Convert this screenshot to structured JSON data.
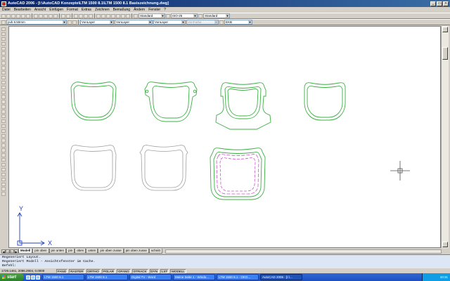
{
  "window": {
    "title": "AutoCAD 2006 - [I:\\AutoCAD Konzepte\\LTM 1500 8.1\\LTM 1500 8.1 Basiszeichnung.dwg]",
    "minimize_label": "_",
    "maximize_label": "□",
    "close_label": "×"
  },
  "menu": {
    "items": [
      {
        "label": "Datei"
      },
      {
        "label": "Bearbeiten"
      },
      {
        "label": "Ansicht"
      },
      {
        "label": "Einfügen"
      },
      {
        "label": "Format"
      },
      {
        "label": "Extras"
      },
      {
        "label": "Zeichnen"
      },
      {
        "label": "Bemaßung"
      },
      {
        "label": "Ändern"
      },
      {
        "label": "Fenster"
      },
      {
        "label": "?"
      }
    ]
  },
  "toolbar": {
    "textstyle": "Standard",
    "dimstyle": "ISO-25",
    "tablestyle": "Standard",
    "layer": "pvb 8.50mm",
    "color": "VonLayer",
    "linetype": "VonLayer",
    "lineweight": "VonLayer",
    "plotstyle": "VonFarbe",
    "extra": "EKB"
  },
  "drawing": {
    "ucs_y": "Y",
    "ucs_x": "X"
  },
  "tabs": {
    "items": [
      {
        "label": "Modell"
      },
      {
        "label": "pin oben"
      },
      {
        "label": "pin unten"
      },
      {
        "label": "pin"
      },
      {
        "label": "oben"
      },
      {
        "label": "unten"
      },
      {
        "label": "pin oben zusse"
      },
      {
        "label": "pin oben zusse"
      },
      {
        "label": "schnitt"
      }
    ]
  },
  "command": {
    "lines": [
      "Regeneriert Layout.",
      "Regeneriert Modell - Ansichtsfenster im Cache."
    ],
    "prompt": "Befehl:"
  },
  "status": {
    "coords": "1729.1461, 2096.2904, 0.0000",
    "buttons": [
      "FANG",
      "RASTER",
      "ORTHO",
      "POLAR",
      "OFANG",
      "OTRACK",
      "DYN",
      "LST",
      "MODELL"
    ]
  },
  "taskbar": {
    "start_label": "start",
    "tasks": [
      {
        "label": "LTM 1500 8.1"
      },
      {
        "label": "LTM 1500 8.1"
      },
      {
        "label": "Digital TV - Word"
      },
      {
        "label": "Meine Seite 1 - Windo..."
      },
      {
        "label": "LTM 1500 8.1 - OKO..."
      },
      {
        "label": "AutoCAD 2006 - [I:\\..."
      }
    ],
    "clock": "10:31"
  },
  "colors": {
    "title_bar": "#0a246a",
    "shape_green": "#3cb043",
    "shape_gray": "#a0a0a0",
    "shape_magenta": "#d050d0",
    "ucs_blue": "#2040c0"
  }
}
